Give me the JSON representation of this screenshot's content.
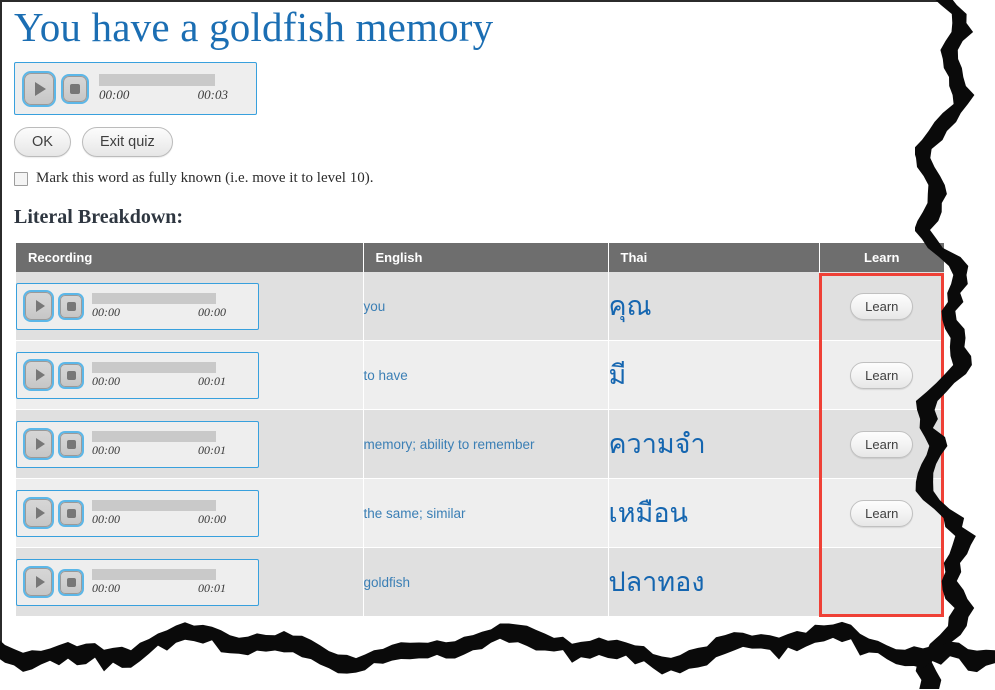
{
  "page": {
    "title": "You have a goldfish memory",
    "section_title": "Literal Breakdown:",
    "title_color": "#1b6eb3",
    "highlight_color": "#ef4036"
  },
  "main_player": {
    "play_label": "play",
    "stop_label": "stop",
    "current_time": "00:00",
    "duration": "00:03"
  },
  "actions": {
    "ok_label": "OK",
    "exit_label": "Exit quiz"
  },
  "mark_known": {
    "label": "Mark this word as fully known (i.e. move it to level 10).",
    "checked": false
  },
  "table": {
    "headers": {
      "recording": "Recording",
      "english": "English",
      "thai": "Thai",
      "learn": "Learn"
    },
    "rows": [
      {
        "current_time": "00:00",
        "duration": "00:00",
        "english": "you",
        "thai": "คุณ",
        "learn_label": "Learn",
        "has_learn": true
      },
      {
        "current_time": "00:00",
        "duration": "00:01",
        "english": "to have",
        "thai": "มี",
        "learn_label": "Learn",
        "has_learn": true
      },
      {
        "current_time": "00:00",
        "duration": "00:01",
        "english": "memory; ability to remember",
        "thai": "ความจำ",
        "learn_label": "Learn",
        "has_learn": true
      },
      {
        "current_time": "00:00",
        "duration": "00:00",
        "english": "the same; similar",
        "thai": "เหมือน",
        "learn_label": "Learn",
        "has_learn": true
      },
      {
        "current_time": "00:00",
        "duration": "00:01",
        "english": "goldfish",
        "thai": "ปลาทอง",
        "learn_label": "",
        "has_learn": false
      }
    ]
  }
}
